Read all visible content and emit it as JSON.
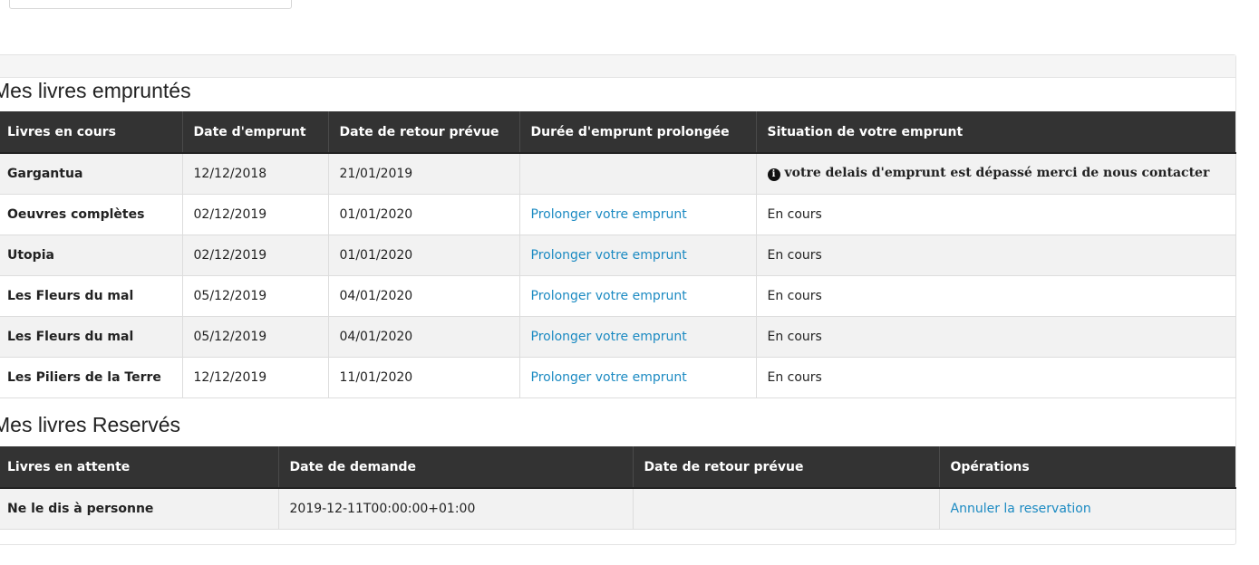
{
  "borrowed": {
    "title": "Mes livres empruntés",
    "headers": [
      "Livres en cours",
      "Date d'emprunt",
      "Date de retour prévue",
      "Durée d'emprunt prolongée",
      "Situation de votre emprunt"
    ],
    "rows": [
      {
        "book": "Gargantua",
        "borrow_date": "12/12/2018",
        "return_date": "21/01/2019",
        "extend": "",
        "status": "votre delais d'emprunt est dépassé merci de nous contacter"
      },
      {
        "book": "Oeuvres complètes",
        "borrow_date": "02/12/2019",
        "return_date": "01/01/2020",
        "extend": "Prolonger votre emprunt",
        "status": "En cours"
      },
      {
        "book": "Utopia",
        "borrow_date": "02/12/2019",
        "return_date": "01/01/2020",
        "extend": "Prolonger votre emprunt",
        "status": "En cours"
      },
      {
        "book": "Les Fleurs du mal",
        "borrow_date": "05/12/2019",
        "return_date": "04/01/2020",
        "extend": "Prolonger votre emprunt",
        "status": "En cours"
      },
      {
        "book": "Les Fleurs du mal",
        "borrow_date": "05/12/2019",
        "return_date": "04/01/2020",
        "extend": "Prolonger votre emprunt",
        "status": "En cours"
      },
      {
        "book": "Les Piliers de la Terre",
        "borrow_date": "12/12/2019",
        "return_date": "11/01/2020",
        "extend": "Prolonger votre emprunt",
        "status": "En cours"
      }
    ]
  },
  "reserved": {
    "title": "Mes livres Reservés",
    "headers": [
      "Livres en attente",
      "Date de demande",
      "Date de retour prévue",
      "Opérations"
    ],
    "rows": [
      {
        "book": "Ne le dis à personne",
        "request_date": "2019-12-11T00:00:00+01:00",
        "return_date": "",
        "operation": "Annuler la reservation"
      }
    ]
  },
  "icons": {
    "warning": "info-circle-icon"
  },
  "colors": {
    "header_bg": "#333333",
    "link": "#1b8ac2",
    "row_alt": "#f2f2f2"
  }
}
